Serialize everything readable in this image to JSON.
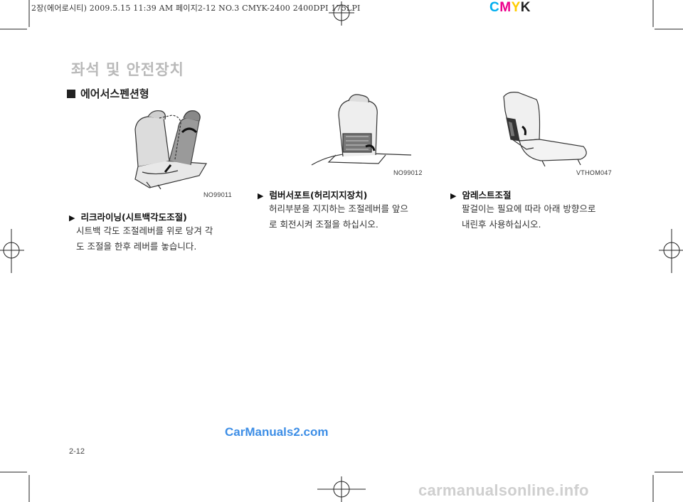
{
  "header": {
    "print_info": "2장(에어로시티)  2009.5.15 11:39 AM  페이지2-12   NO.3 CMYK-2400 2400DPI 175LPI",
    "cmyk": [
      "C",
      "M",
      "Y",
      "K"
    ],
    "cmyk_colors": [
      "#00aeef",
      "#ec008c",
      "#ffcc00",
      "#222222"
    ]
  },
  "section": {
    "title": "좌석 및 안전장치",
    "subsection": "에어서스펜션형"
  },
  "items": [
    {
      "image_code": "NO99011",
      "title": "리크라이닝(시트백각도조절)",
      "lines": [
        "시트백 각도 조절레버를 위로 당겨 각",
        "도 조절을 한후 레버를 놓습니다."
      ]
    },
    {
      "image_code": "NO99012",
      "title": "럼버서포트(허리지지장치)",
      "lines": [
        "허리부분을 지지하는 조절레버를 앞으",
        "로 회전시켜 조절을 하십시오."
      ]
    },
    {
      "image_code": "VTHOM047",
      "title": "암레스트조절",
      "lines": [
        "팔걸이는 필요에 따라 아래 방향으로",
        "내린후 사용하십시오."
      ]
    }
  ],
  "footer": {
    "page_number": "2-12",
    "brand": "CarManuals2.com",
    "watermark": "carmanualsonline.info"
  }
}
